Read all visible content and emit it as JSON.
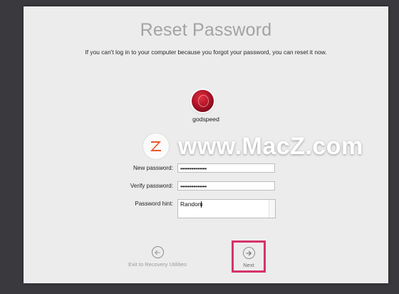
{
  "screen": {
    "title": "Reset Password",
    "subtitle": "If you can't log in to your computer because you forgot your password, you can reset it now.",
    "user": {
      "name": "godspeed"
    },
    "form": {
      "new_password_label": "New password:",
      "new_password_value": "••••••••••••••",
      "verify_password_label": "Verify password:",
      "verify_password_value": "••••••••••••••",
      "hint_label": "Password hint:",
      "hint_value": "Random"
    },
    "buttons": {
      "back_label": "Exit to Recovery Utilities",
      "next_label": "Next"
    }
  },
  "watermark": {
    "text": "www.MacZ.com",
    "logo_letter": "Z"
  },
  "colors": {
    "desktop": "#3a3a3e",
    "window": "#ececec",
    "highlight": "#d6336c",
    "watermark_logo": "#e8572b"
  }
}
